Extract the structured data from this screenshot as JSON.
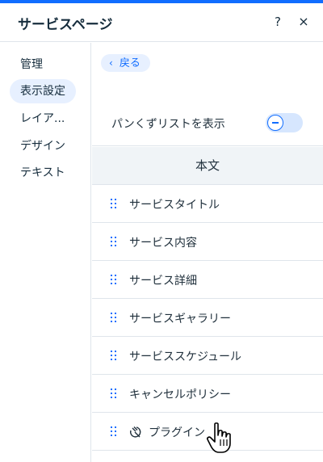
{
  "header": {
    "title": "サービスページ",
    "help_label": "?",
    "close_label": "×"
  },
  "sidebar": {
    "items": [
      {
        "label": "管理",
        "active": false
      },
      {
        "label": "表示設定",
        "active": true
      },
      {
        "label": "レイア...",
        "active": false
      },
      {
        "label": "デザイン",
        "active": false
      },
      {
        "label": "テキスト",
        "active": false
      }
    ]
  },
  "content": {
    "back_label": "戻る",
    "breadcrumb_toggle": {
      "label": "パンくずリストを表示",
      "on": false
    },
    "section_title": "本文",
    "items": [
      {
        "label": "サービスタイトル"
      },
      {
        "label": "サービス内容"
      },
      {
        "label": "サービス詳細"
      },
      {
        "label": "サービスギャラリー"
      },
      {
        "label": "サービススケジュール"
      },
      {
        "label": "キャンセルポリシー"
      },
      {
        "label": "プラグイン",
        "icon": "plugin-icon"
      }
    ]
  },
  "colors": {
    "accent": "#116dff",
    "accent_light": "#e7f0ff",
    "divider": "#dfe5eb",
    "section_bg": "#f0f4f7"
  }
}
